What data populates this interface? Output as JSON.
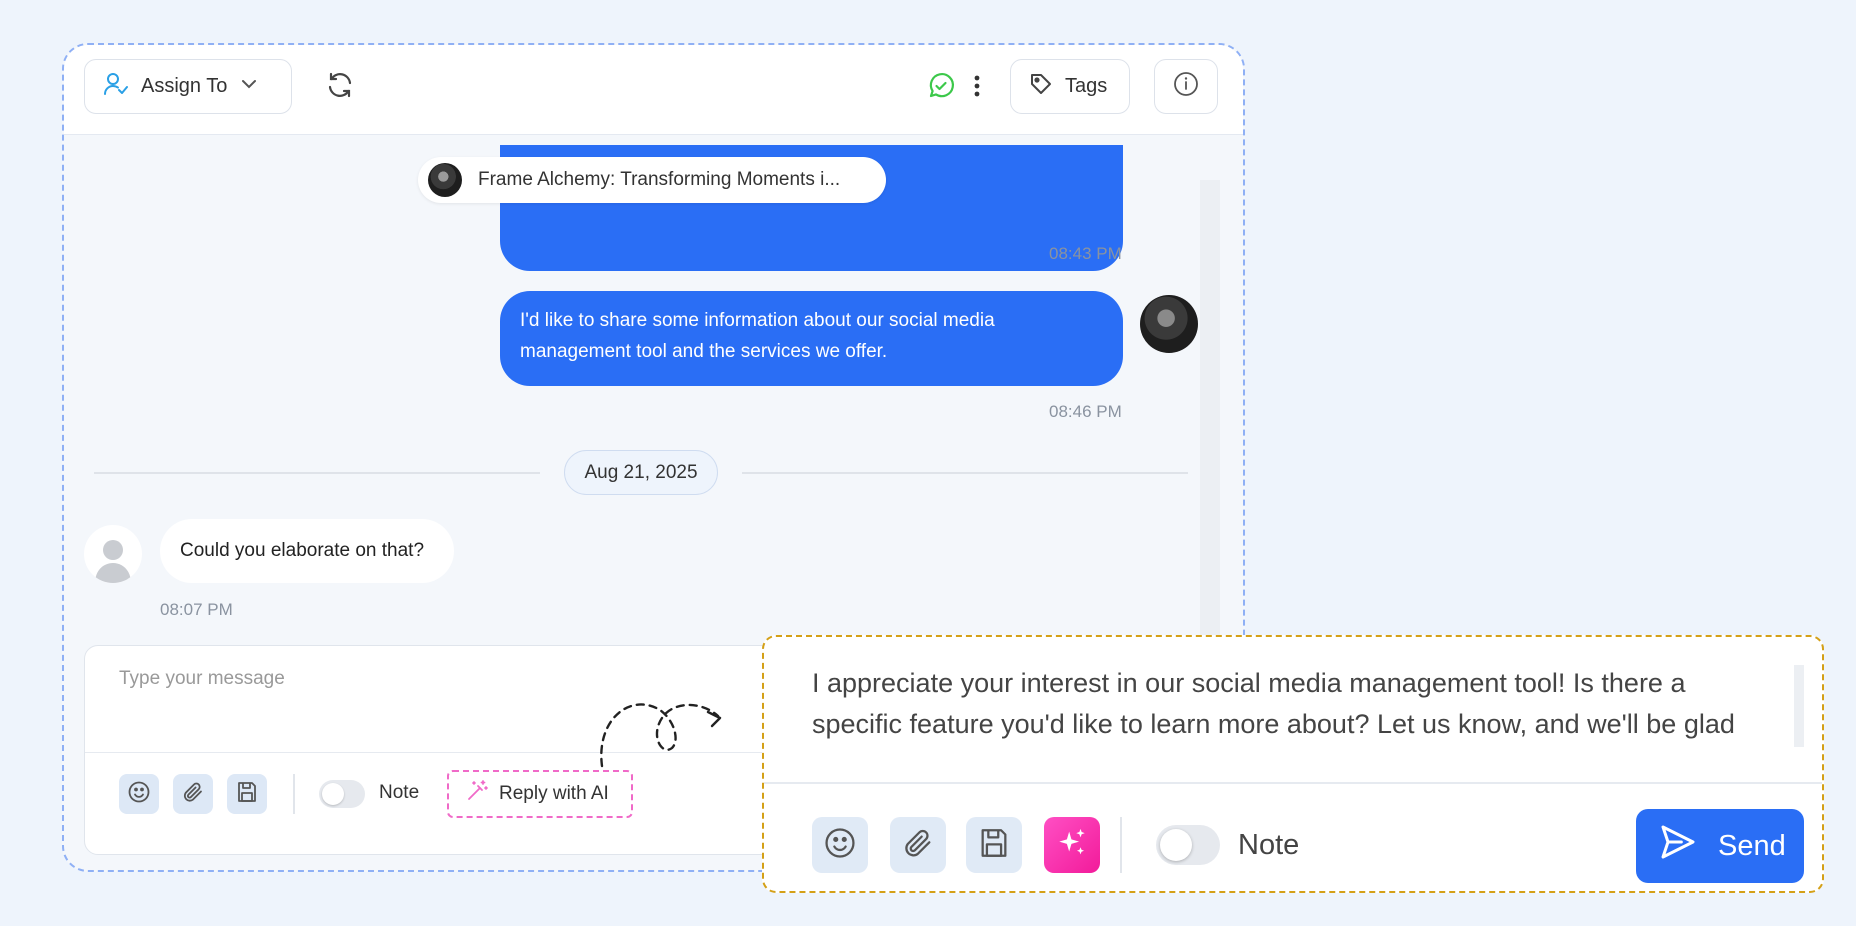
{
  "header": {
    "assign_label": "Assign To",
    "tags_label": "Tags"
  },
  "conversation": {
    "pinned_title": "Frame Alchemy: Transforming Moments i...",
    "msg1_time": "08:43 PM",
    "msg2_text": "I'd like to share some information about our social media management tool and the services we offer.",
    "msg2_time": "08:46 PM",
    "date_divider": "Aug 21, 2025",
    "msg3_text": "Could you elaborate on that?",
    "msg3_time": "08:07 PM"
  },
  "composer": {
    "placeholder": "Type your message",
    "note_label": "Note",
    "reply_ai_label": "Reply with AI"
  },
  "zoom": {
    "text": "I appreciate your interest in our social media management tool!  Is there a specific feature you'd like to learn more about? Let us know, and we'll be glad",
    "note_label": "Note",
    "send_label": "Send"
  },
  "colors": {
    "accent": "#2a6ef5",
    "ai_pink": "#f21b9a",
    "whatsapp_green": "#3cc84a",
    "panel_border": "#8fb0f5",
    "zoom_border": "#d4a017"
  }
}
